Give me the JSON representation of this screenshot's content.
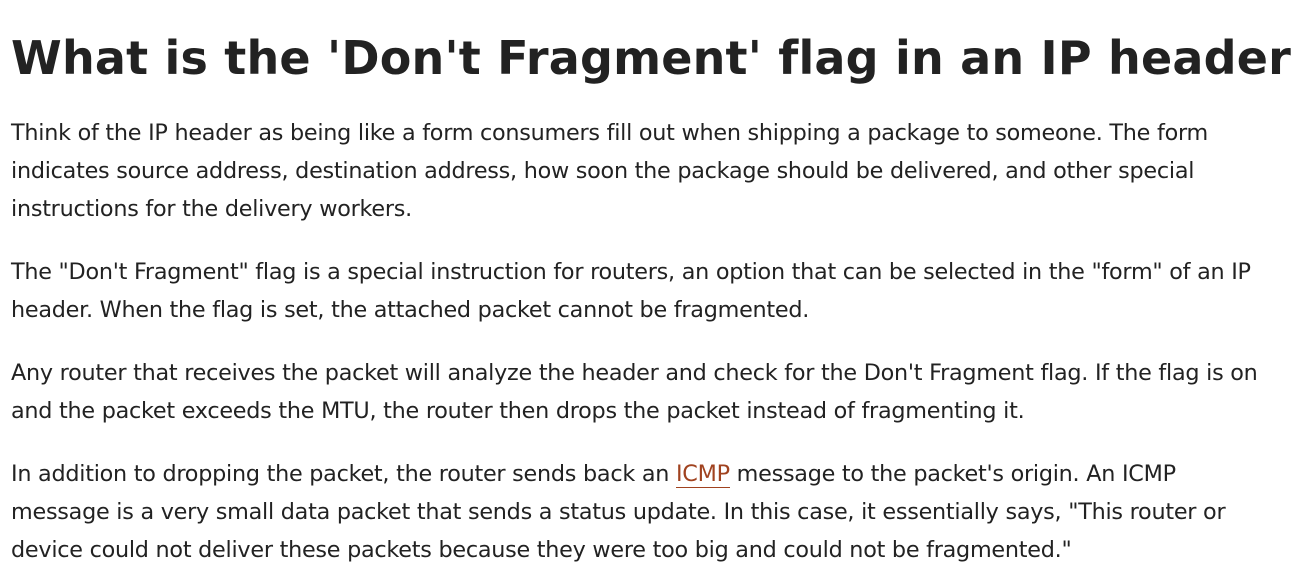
{
  "article": {
    "title": "What is the 'Don't Fragment' flag in an IP header?",
    "paragraphs": [
      {
        "text": "Think of the IP header as being like a form consumers fill out when shipping a package to someone. The form indicates source address, destination address, how soon the package should be delivered, and other special instructions for the delivery workers."
      },
      {
        "text": "The \"Don't Fragment\" flag is a special instruction for routers, an option that can be selected in the \"form\" of an IP header. When the flag is set, the attached packet cannot be fragmented."
      },
      {
        "text": "Any router that receives the packet will analyze the header and check for the Don't Fragment flag. If the flag is on and the packet exceeds the MTU, the router then drops the packet instead of fragmenting it."
      },
      {
        "before": "In addition to dropping the packet, the router sends back an ",
        "link": "ICMP",
        "after": " message to the packet's origin. An ICMP message is a very small data packet that sends a status update. In this case, it essentially says, \"This router or device could not deliver these packets because they were too big and could not be fragmented.\""
      }
    ]
  },
  "colors": {
    "text": "#222222",
    "link": "#a0421f",
    "background": "#ffffff"
  }
}
